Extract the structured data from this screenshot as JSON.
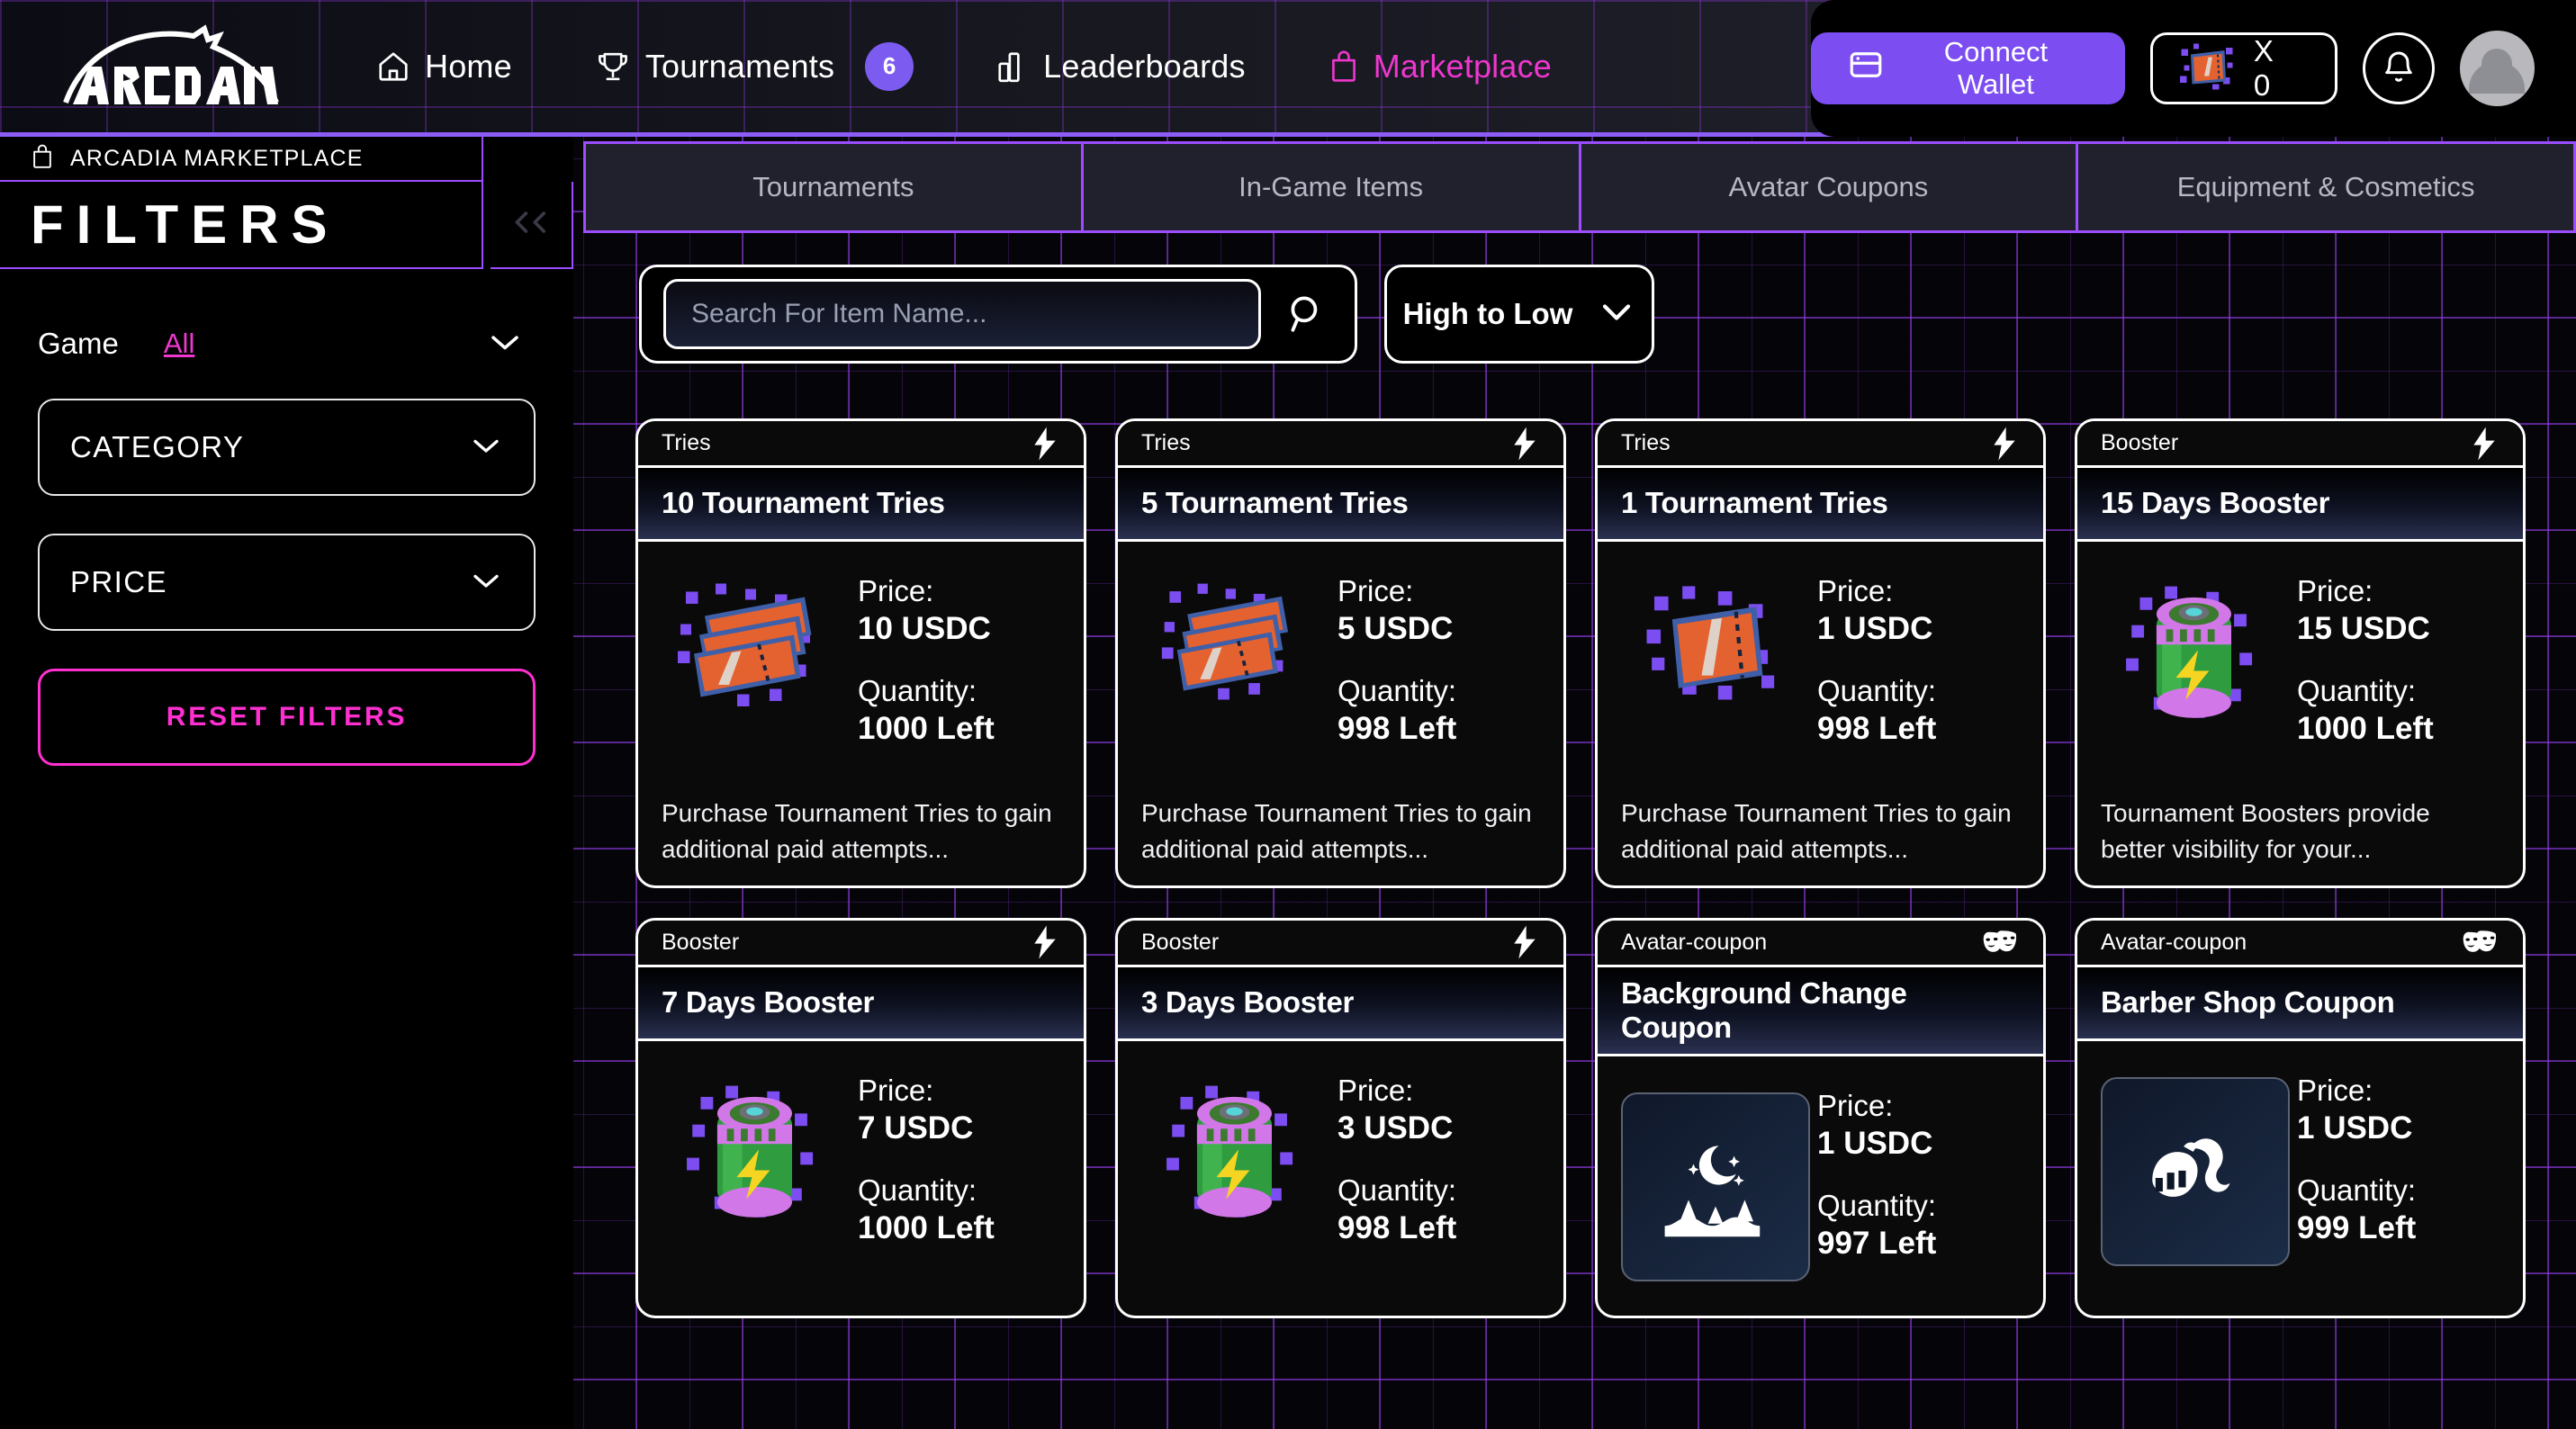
{
  "brand": {
    "logo_text": "ARCADIA"
  },
  "topnav": {
    "links": [
      {
        "label": "Home",
        "icon": "home-icon",
        "active": false,
        "badge": null
      },
      {
        "label": "Tournaments",
        "icon": "trophy-icon",
        "active": false,
        "badge": "6"
      },
      {
        "label": "Leaderboards",
        "icon": "bar-chart-icon",
        "active": false,
        "badge": null
      },
      {
        "label": "Marketplace",
        "icon": "shopping-bag-icon",
        "active": true,
        "badge": null
      }
    ],
    "connect_wallet_label": "Connect Wallet",
    "token_amount": "X 0",
    "notifications_icon": "bell-icon",
    "avatar_icon": "user-avatar"
  },
  "sidebar": {
    "header_label": "ARCADIA MARKETPLACE",
    "header_icon": "shopping-bag-icon",
    "title": "FILTERS",
    "collapse_icon": "double-chevron-left-icon",
    "game_label": "Game",
    "game_value": "All",
    "category_label": "CATEGORY",
    "price_label": "PRICE",
    "reset_label": "RESET FILTERS"
  },
  "tabs": [
    {
      "label": "Tournaments",
      "active": false
    },
    {
      "label": "In-Game Items",
      "active": false
    },
    {
      "label": "Avatar Coupons",
      "active": false
    },
    {
      "label": "Equipment & Cosmetics",
      "active": false
    }
  ],
  "search": {
    "placeholder": "Search For Item Name...",
    "value": "",
    "icon": "search-icon"
  },
  "sort": {
    "value": "High to Low",
    "icon": "chevron-down-icon"
  },
  "cards": [
    {
      "category": "Tries",
      "badge_icon": "lightning-bolt-icon",
      "title": "10 Tournament Tries",
      "thumb_icon": "ticket-stack-icon",
      "price_label": "Price:",
      "price": "10 USDC",
      "quantity_label": "Quantity:",
      "quantity": "1000 Left",
      "description": "Purchase Tournament Tries to gain additional paid attempts..."
    },
    {
      "category": "Tries",
      "badge_icon": "lightning-bolt-icon",
      "title": "5 Tournament Tries",
      "thumb_icon": "ticket-stack-icon",
      "price_label": "Price:",
      "price": "5 USDC",
      "quantity_label": "Quantity:",
      "quantity": "998 Left",
      "description": "Purchase Tournament Tries to gain additional paid attempts..."
    },
    {
      "category": "Tries",
      "badge_icon": "lightning-bolt-icon",
      "title": "1 Tournament Tries",
      "thumb_icon": "ticket-single-icon",
      "price_label": "Price:",
      "price": "1 USDC",
      "quantity_label": "Quantity:",
      "quantity": "998 Left",
      "description": "Purchase Tournament Tries to gain additional paid attempts..."
    },
    {
      "category": "Booster",
      "badge_icon": "lightning-bolt-icon",
      "title": "15 Days Booster",
      "thumb_icon": "battery-booster-icon",
      "price_label": "Price:",
      "price": "15 USDC",
      "quantity_label": "Quantity:",
      "quantity": "1000 Left",
      "description": "Tournament Boosters provide better visibility for your..."
    },
    {
      "category": "Booster",
      "badge_icon": "lightning-bolt-icon",
      "title": "7 Days Booster",
      "thumb_icon": "battery-booster-icon",
      "price_label": "Price:",
      "price": "7 USDC",
      "quantity_label": "Quantity:",
      "quantity": "1000 Left",
      "description": ""
    },
    {
      "category": "Booster",
      "badge_icon": "lightning-bolt-icon",
      "title": "3 Days Booster",
      "thumb_icon": "battery-booster-icon",
      "price_label": "Price:",
      "price": "3 USDC",
      "quantity_label": "Quantity:",
      "quantity": "998 Left",
      "description": ""
    },
    {
      "category": "Avatar-coupon",
      "badge_icon": "theater-masks-icon",
      "title": "Background Change Coupon",
      "thumb_icon": "night-scene-icon",
      "price_label": "Price:",
      "price": "1 USDC",
      "quantity_label": "Quantity:",
      "quantity": "997 Left",
      "description": ""
    },
    {
      "category": "Avatar-coupon",
      "badge_icon": "theater-masks-icon",
      "title": "Barber Shop Coupon",
      "thumb_icon": "hairstyle-icon",
      "price_label": "Price:",
      "price": "1 USDC",
      "quantity_label": "Quantity:",
      "quantity": "999 Left",
      "description": ""
    }
  ],
  "colors": {
    "accent_purple": "#7c4df0",
    "grid_purple": "#9b4dff",
    "accent_pink": "#ee37ce",
    "reset_pink": "#ff2fd0",
    "tab_bg": "#21212e",
    "page_bg": "#050509"
  }
}
